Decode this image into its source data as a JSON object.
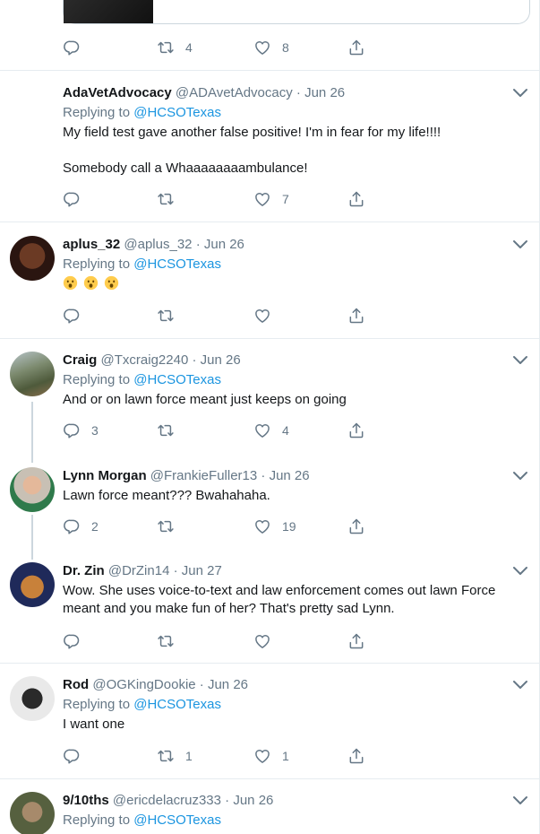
{
  "top_tweet": {
    "retweets": "4",
    "likes": "8"
  },
  "tweets": [
    {
      "display_name": "AdaVetAdvocacy",
      "handle": "@ADAvetAdvocacy",
      "date": "Jun 26",
      "replying_to_label": "Replying to",
      "replying_to": "@HCSOTexas",
      "text_line1": "My field test gave another false positive! I'm in fear for my life!!!!",
      "text_line2": "Somebody call a Whaaaaaaaambulance!",
      "replies": "",
      "retweets": "",
      "likes": "7"
    },
    {
      "display_name": "aplus_32",
      "handle": "@aplus_32",
      "date": "Jun 26",
      "replying_to_label": "Replying to",
      "replying_to": "@HCSOTexas",
      "emoji": [
        "hushed-face-emoji",
        "hushed-face-emoji",
        "hushed-face-emoji"
      ],
      "replies": "",
      "retweets": "",
      "likes": ""
    },
    {
      "display_name": "Craig",
      "handle": "@Txcraig2240",
      "date": "Jun 26",
      "replying_to_label": "Replying to",
      "replying_to": "@HCSOTexas",
      "text": "And or on lawn force meant just keeps on going",
      "replies": "3",
      "retweets": "",
      "likes": "4"
    },
    {
      "display_name": "Lynn Morgan",
      "handle": "@FrankieFuller13",
      "date": "Jun 26",
      "text": "Lawn force meant??? Bwahahaha.",
      "replies": "2",
      "retweets": "",
      "likes": "19"
    },
    {
      "display_name": "Dr. Zin",
      "handle": "@DrZin14",
      "date": "Jun 27",
      "text_line1": "Wow. She uses voice-to-text and law enforcement comes out lawn Force",
      "text_line2": "meant and you make fun of her? That's pretty sad Lynn.",
      "replies": "",
      "retweets": "",
      "likes": ""
    },
    {
      "display_name": "Rod",
      "handle": "@OGKingDookie",
      "date": "Jun 26",
      "replying_to_label": "Replying to",
      "replying_to": "@HCSOTexas",
      "text": "I want one",
      "replies": "",
      "retweets": "1",
      "likes": "1"
    },
    {
      "display_name": "9/10ths",
      "handle": "@ericdelacruz333",
      "date": "Jun 26",
      "replying_to_label": "Replying to",
      "replying_to": "@HCSOTexas"
    }
  ],
  "colors": {
    "text": "#14171a",
    "secondary": "#657786",
    "link": "#1b95e0",
    "border": "#e6ecf0",
    "thread": "#ccd6dd"
  }
}
